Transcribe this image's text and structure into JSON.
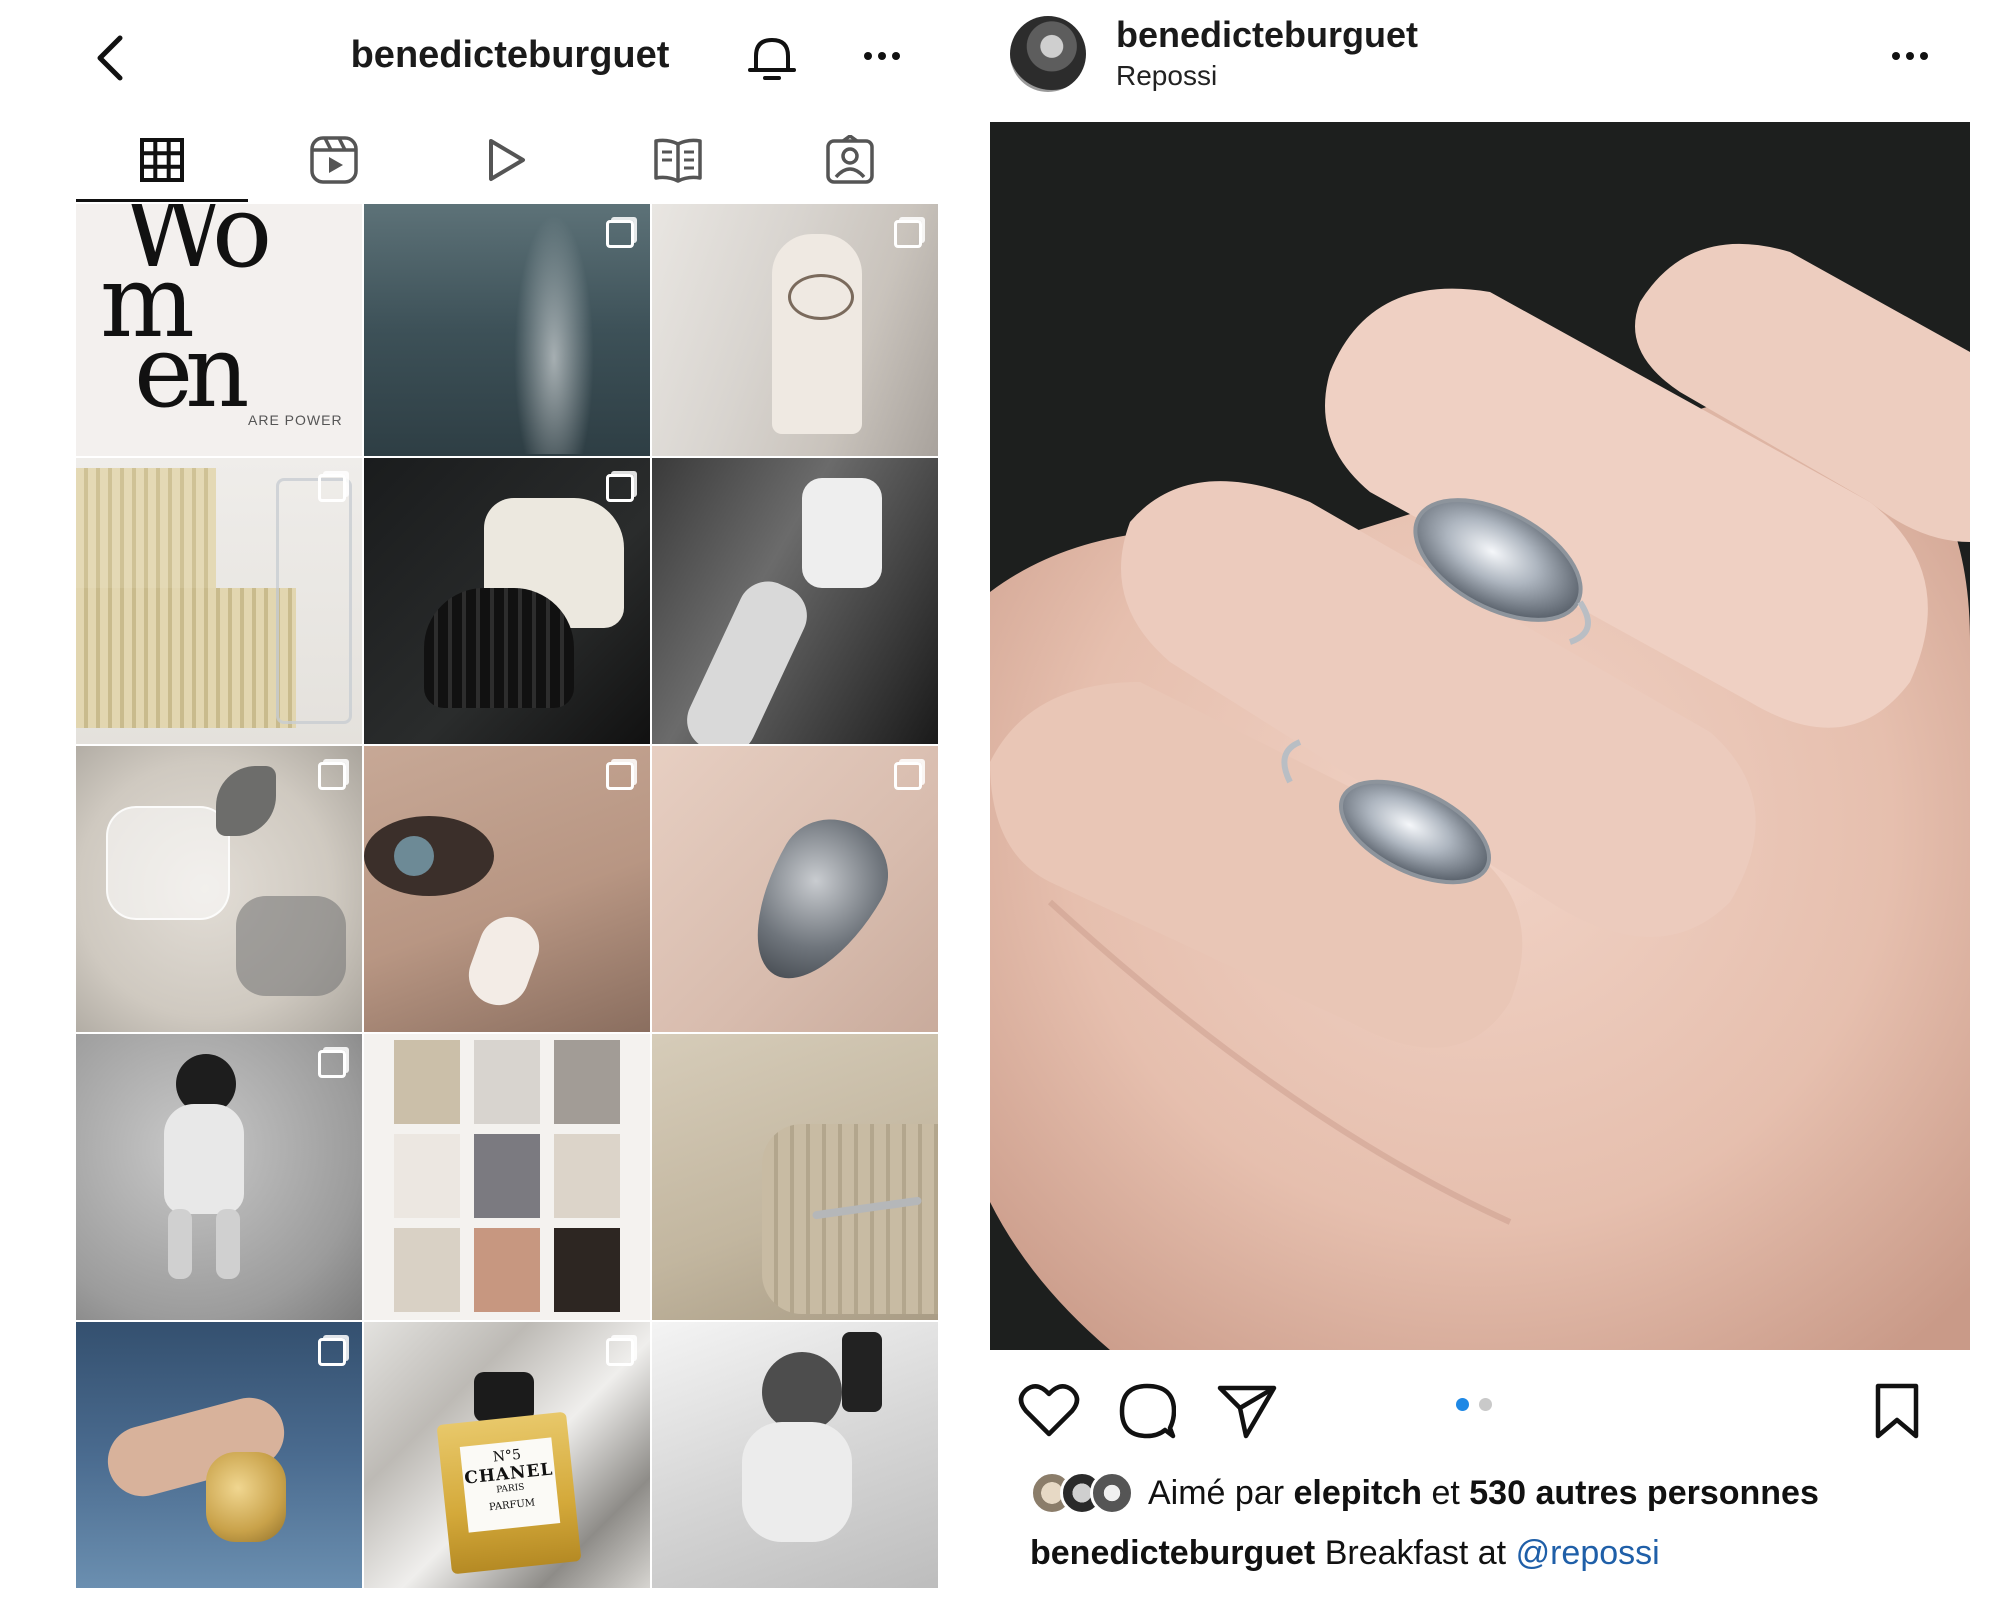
{
  "profile": {
    "username": "benedicteburguet",
    "tabs": [
      "grid-icon",
      "reels-icon",
      "video-icon",
      "guides-icon",
      "tagged-icon"
    ]
  },
  "grid": {
    "women_tile": {
      "line1": "Wo",
      "line2": "m",
      "line3": "en",
      "tagline": "ARE POWER"
    },
    "perfume_label": {
      "brand_line1": "N°5",
      "brand_line2": "CHANEL",
      "brand_line3": "PARIS",
      "brand_line4": "PARFUM"
    }
  },
  "post": {
    "username": "benedicteburguet",
    "location": "Repossi",
    "carousel": {
      "current": 1,
      "total": 2
    },
    "likes": {
      "prefix": "Aimé par",
      "user": "elepitch",
      "connector": "et",
      "others": "530 autres personnes"
    },
    "caption": {
      "author": "benedicteburguet",
      "text": "Breakfast at",
      "mention": "@repossi"
    }
  },
  "colors": {
    "accent_dot": "#1e88e5",
    "dot_inactive": "#c9c9c9",
    "mention": "#1f5fa8"
  }
}
